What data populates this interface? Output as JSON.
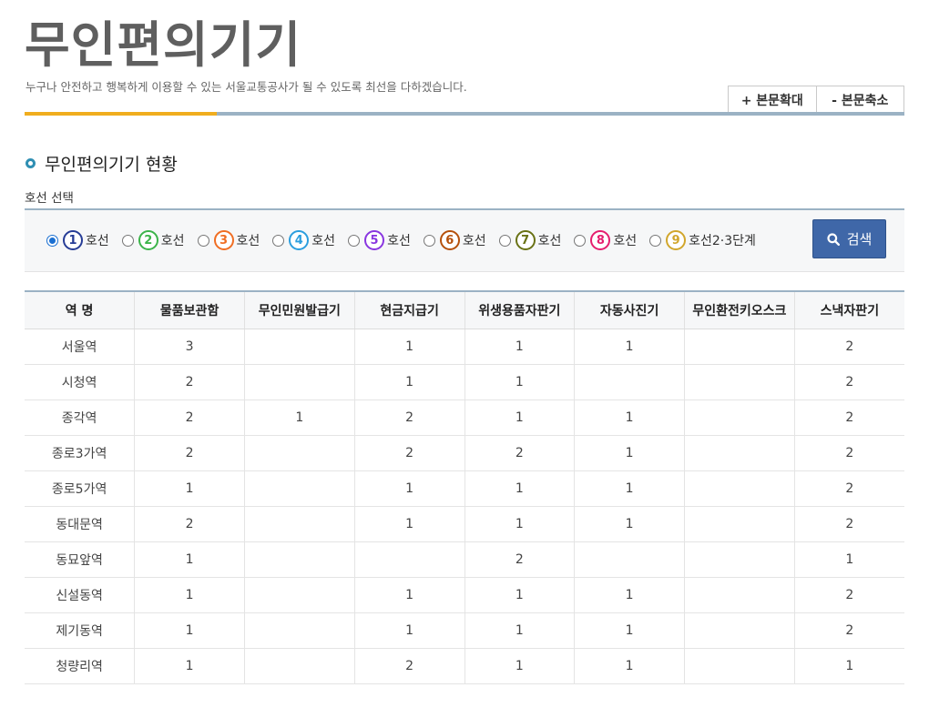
{
  "page": {
    "title": "무인편의기기",
    "subtitle": "누구나 안전하고 행복하게 이용할 수 있는 서울교통공사가 될 수 있도록 최선을 다하겠습니다."
  },
  "zoom": {
    "zoom_in_label": "+ 본문확대",
    "zoom_out_label": "- 본문축소"
  },
  "section": {
    "title": "무인편의기기 현황",
    "line_select_label": "호선 선택"
  },
  "lines": [
    {
      "num": "1",
      "label": "호선",
      "color": "#263c96",
      "selected": true
    },
    {
      "num": "2",
      "label": "호선",
      "color": "#3cb44a",
      "selected": false
    },
    {
      "num": "3",
      "label": "호선",
      "color": "#f06e23",
      "selected": false
    },
    {
      "num": "4",
      "label": "호선",
      "color": "#2c9ede",
      "selected": false
    },
    {
      "num": "5",
      "label": "호선",
      "color": "#8936e0",
      "selected": false
    },
    {
      "num": "6",
      "label": "호선",
      "color": "#b5500b",
      "selected": false
    },
    {
      "num": "7",
      "label": "호선",
      "color": "#697215",
      "selected": false
    },
    {
      "num": "8",
      "label": "호선",
      "color": "#e51e6e",
      "selected": false
    },
    {
      "num": "9",
      "label": "호선2·3단계",
      "color": "#d1a62c",
      "selected": false
    }
  ],
  "search": {
    "label": "검색",
    "icon": "search-icon"
  },
  "table": {
    "headers": [
      "역 명",
      "물품보관함",
      "무인민원발급기",
      "현금지급기",
      "위생용품자판기",
      "자동사진기",
      "무인환전키오스크",
      "스낵자판기"
    ],
    "rows": [
      [
        "서울역",
        "3",
        "",
        "1",
        "1",
        "1",
        "",
        "2"
      ],
      [
        "시청역",
        "2",
        "",
        "1",
        "1",
        "",
        "",
        "2"
      ],
      [
        "종각역",
        "2",
        "1",
        "2",
        "1",
        "1",
        "",
        "2"
      ],
      [
        "종로3가역",
        "2",
        "",
        "2",
        "2",
        "1",
        "",
        "2"
      ],
      [
        "종로5가역",
        "1",
        "",
        "1",
        "1",
        "1",
        "",
        "2"
      ],
      [
        "동대문역",
        "2",
        "",
        "1",
        "1",
        "1",
        "",
        "2"
      ],
      [
        "동묘앞역",
        "1",
        "",
        "",
        "2",
        "",
        "",
        "1"
      ],
      [
        "신설동역",
        "1",
        "",
        "1",
        "1",
        "1",
        "",
        "2"
      ],
      [
        "제기동역",
        "1",
        "",
        "1",
        "1",
        "1",
        "",
        "2"
      ],
      [
        "청량리역",
        "1",
        "",
        "2",
        "1",
        "1",
        "",
        "1"
      ]
    ]
  }
}
